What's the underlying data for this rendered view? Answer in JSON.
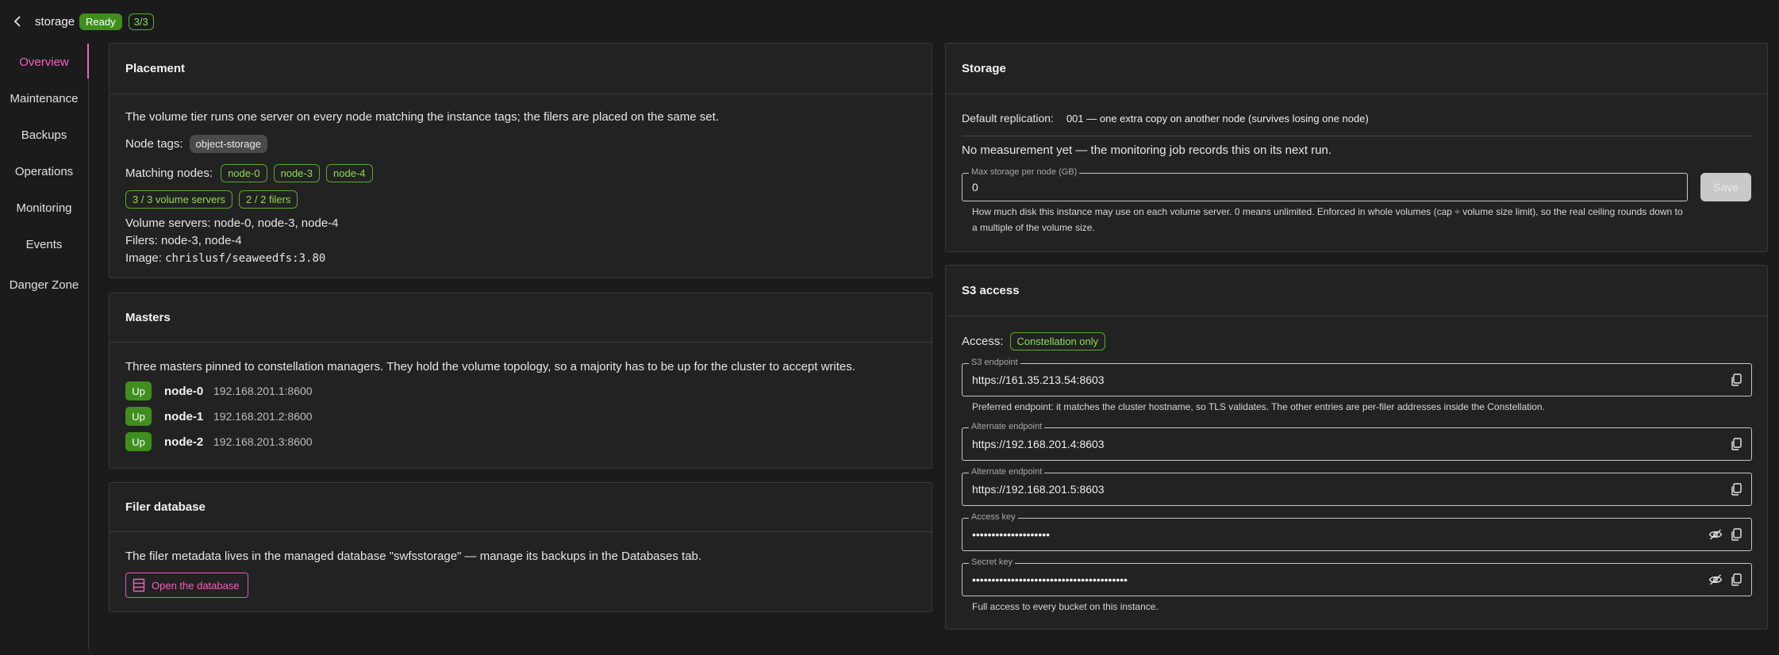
{
  "header": {
    "title": "storage",
    "status": "Ready",
    "count": "3/3"
  },
  "sidebar": {
    "items": [
      {
        "label": "Overview"
      },
      {
        "label": "Maintenance"
      },
      {
        "label": "Backups"
      },
      {
        "label": "Operations"
      },
      {
        "label": "Monitoring"
      },
      {
        "label": "Events"
      },
      {
        "label": "Danger Zone"
      }
    ]
  },
  "placement": {
    "title": "Placement",
    "description": "The volume tier runs one server on every node matching the instance tags; the filers are placed on the same set.",
    "node_tags_label": "Node tags:",
    "node_tag": "object-storage",
    "matching_label": "Matching nodes:",
    "matching_nodes": [
      "node-0",
      "node-3",
      "node-4"
    ],
    "volume_servers_chip": "3 / 3 volume servers",
    "filers_chip": "2 / 2 filers",
    "volume_servers_line": "Volume servers: node-0, node-3, node-4",
    "filers_line": "Filers: node-3, node-4",
    "image_label": "Image:",
    "image_value": "chrislusf/seaweedfs:3.80"
  },
  "masters": {
    "title": "Masters",
    "description": "Three masters pinned to constellation managers. They hold the volume topology, so a majority has to be up for the cluster to accept writes.",
    "rows": [
      {
        "status": "Up",
        "name": "node-0",
        "ip": "192.168.201.1:8600"
      },
      {
        "status": "Up",
        "name": "node-1",
        "ip": "192.168.201.2:8600"
      },
      {
        "status": "Up",
        "name": "node-2",
        "ip": "192.168.201.3:8600"
      }
    ]
  },
  "filer_db": {
    "title": "Filer database",
    "description": "The filer metadata lives in the managed database \"swfsstorage\" — manage its backups in the Databases tab.",
    "button": "Open the database"
  },
  "storage": {
    "title": "Storage",
    "replication_label": "Default replication:",
    "replication_value": "001 — one extra copy on another node (survives losing one node)",
    "measurement": "No measurement yet — the monitoring job records this on its next run.",
    "max_label": "Max storage per node (GB)",
    "max_value": "0",
    "save": "Save",
    "help": "How much disk this instance may use on each volume server. 0 means unlimited. Enforced in whole volumes (cap ÷ volume size limit), so the real ceiling rounds down to a multiple of the volume size."
  },
  "s3": {
    "title": "S3 access",
    "access_label": "Access:",
    "access_value": "Constellation only",
    "endpoint_label": "S3 endpoint",
    "endpoint_value": "https://161.35.213.54:8603",
    "endpoint_help": "Preferred endpoint: it matches the cluster hostname, so TLS validates. The other entries are per-filer addresses inside the Constellation.",
    "alt1_label": "Alternate endpoint",
    "alt1_value": "https://192.168.201.4:8603",
    "alt2_label": "Alternate endpoint",
    "alt2_value": "https://192.168.201.5:8603",
    "access_key_label": "Access key",
    "access_key_value": "••••••••••••••••••••",
    "secret_key_label": "Secret key",
    "secret_key_value": "••••••••••••••••••••••••••••••••••••••••",
    "footer": "Full access to every bucket on this instance."
  },
  "colors": {
    "accent": "#f062c0",
    "success": "#3f8f1e",
    "success_text": "#8fdb5c"
  }
}
